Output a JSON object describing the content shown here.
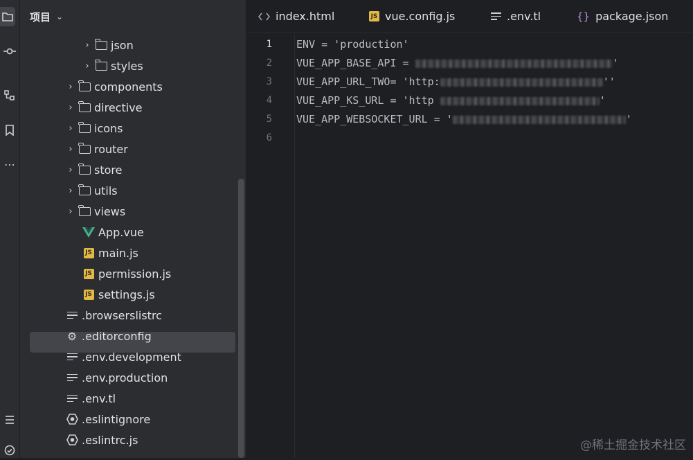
{
  "toolstrip": {
    "icons": [
      "folder-icon",
      "commit-icon",
      "structure-icon",
      "bookmark-icon",
      "more-icon",
      "todo-icon",
      "problems-icon"
    ]
  },
  "project_panel": {
    "title": "项目",
    "items": [
      {
        "label": "json",
        "type": "folder",
        "level": 3
      },
      {
        "label": "styles",
        "type": "folder",
        "level": 3
      },
      {
        "label": "components",
        "type": "folder",
        "level": 2
      },
      {
        "label": "directive",
        "type": "folder",
        "level": 2
      },
      {
        "label": "icons",
        "type": "folder",
        "level": 2
      },
      {
        "label": "router",
        "type": "folder",
        "level": 2
      },
      {
        "label": "store",
        "type": "folder",
        "level": 2
      },
      {
        "label": "utils",
        "type": "folder",
        "level": 2
      },
      {
        "label": "views",
        "type": "folder",
        "level": 2
      },
      {
        "label": "App.vue",
        "type": "vue",
        "level": 2
      },
      {
        "label": "main.js",
        "type": "js",
        "level": 2
      },
      {
        "label": "permission.js",
        "type": "js",
        "level": 2
      },
      {
        "label": "settings.js",
        "type": "js",
        "level": 2
      },
      {
        "label": ".browserslistrc",
        "type": "text",
        "level": 1
      },
      {
        "label": ".editorconfig",
        "type": "gear",
        "level": 1
      },
      {
        "label": ".env.development",
        "type": "text",
        "level": 1
      },
      {
        "label": ".env.production",
        "type": "text",
        "level": 1,
        "selected": true
      },
      {
        "label": ".env.tl",
        "type": "text",
        "level": 1
      },
      {
        "label": ".eslintignore",
        "type": "eslint",
        "level": 1
      },
      {
        "label": ".eslintrc.js",
        "type": "eslint",
        "level": 1
      }
    ]
  },
  "tabs": [
    {
      "label": "index.html",
      "icon": "html-icon"
    },
    {
      "label": "vue.config.js",
      "icon": "js-icon"
    },
    {
      "label": ".env.tl",
      "icon": "text-file-icon"
    },
    {
      "label": "package.json",
      "icon": "json-icon"
    }
  ],
  "editor": {
    "line_numbers": [
      "1",
      "2",
      "3",
      "4",
      "5",
      "6"
    ],
    "lines": [
      {
        "text": "ENV = 'production'"
      },
      {
        "text": "VUE_APP_BASE_API = "
      },
      {
        "text": "VUE_APP_URL_TWO= 'http:"
      },
      {
        "text": "VUE_APP_KS_URL = 'http "
      },
      {
        "text": "VUE_APP_WEBSOCKET_URL = '"
      },
      {
        "text": ""
      }
    ]
  },
  "watermark": "@稀土掘金技术社区"
}
